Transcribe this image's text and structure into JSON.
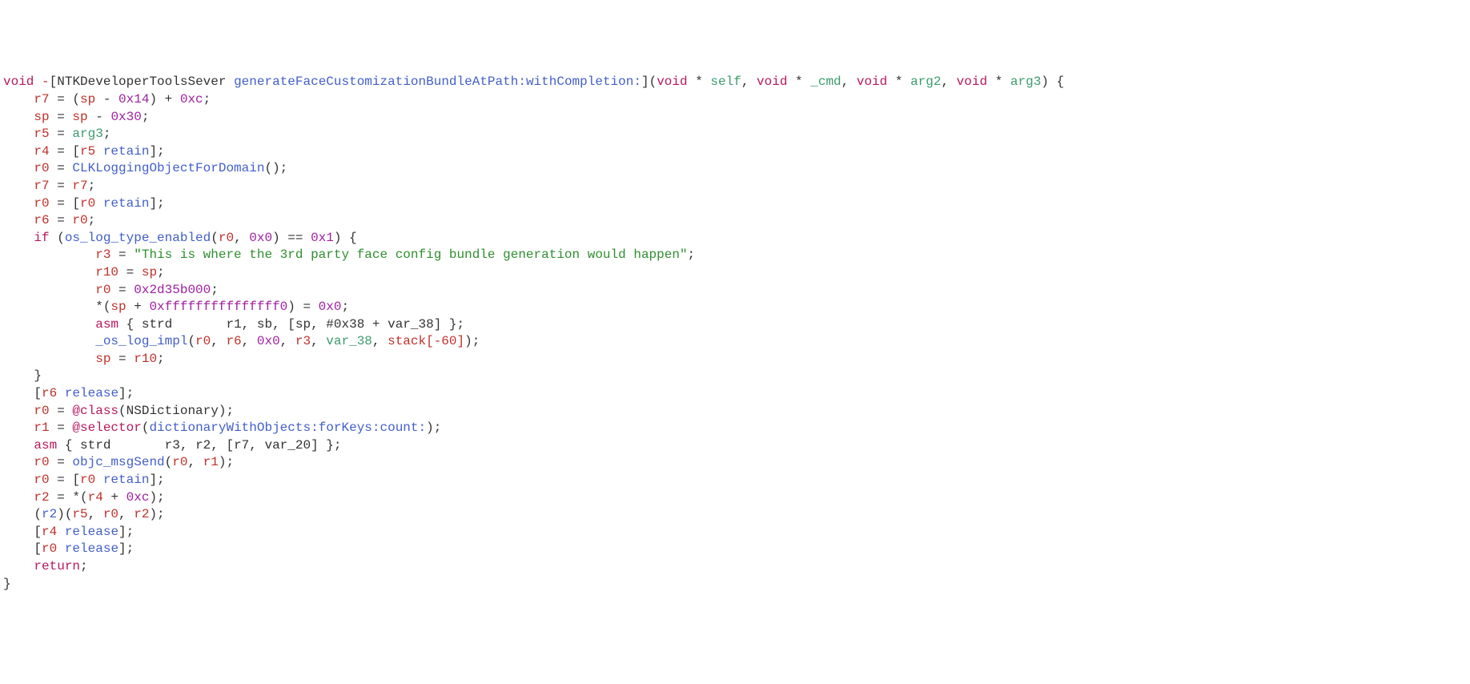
{
  "sig": {
    "ret": "void",
    "minus": "-",
    "lbracket": "[",
    "cls": "NTKDeveloperToolsSever",
    "sel": "generateFaceCustomizationBundleAtPath:withCompletion:",
    "rbracket": "]",
    "lparen": "(",
    "p1t": "void",
    "p1s": " * ",
    "p1n": "self",
    "c1": ", ",
    "p2t": "void",
    "p2s": " * ",
    "p2n": "_cmd",
    "c2": ", ",
    "p3t": "void",
    "p3s": " * ",
    "p3n": "arg2",
    "c3": ", ",
    "p4t": "void",
    "p4s": " * ",
    "p4n": "arg3",
    "rparen": ")",
    "obrace": " {"
  },
  "l1": {
    "r": "r7",
    "eq": " = (",
    "sp": "sp",
    "minus": " - ",
    "v1": "0x14",
    "mid": ") + ",
    "v2": "0xc",
    "end": ";"
  },
  "l2": {
    "r": "sp",
    "eq": " = ",
    "sp2": "sp",
    "minus": " - ",
    "v": "0x30",
    "end": ";"
  },
  "l3": {
    "r": "r5",
    "eq": " = ",
    "a": "arg3",
    "end": ";"
  },
  "l4": {
    "r": "r4",
    "eq": " = [",
    "r2": "r5",
    "sp": " ",
    "m": "retain",
    "end": "];"
  },
  "l5": {
    "r": "r0",
    "eq": " = ",
    "f": "CLKLoggingObjectForDomain",
    "p": "();"
  },
  "l6": {
    "r": "r7",
    "eq": " = ",
    "r2": "r7",
    "end": ";"
  },
  "l7": {
    "r": "r0",
    "eq": " = [",
    "r2": "r0",
    "sp": " ",
    "m": "retain",
    "end": "];"
  },
  "l8": {
    "r": "r6",
    "eq": " = ",
    "r2": "r0",
    "end": ";"
  },
  "l9": {
    "kw": "if",
    "lp": " (",
    "f": "os_log_type_enabled",
    "lpar": "(",
    "a1": "r0",
    "c": ", ",
    "a2": "0x0",
    "rpar": ")",
    "eq": " == ",
    "v": "0x1",
    "rp": ") {"
  },
  "l10": {
    "r": "r3",
    "eq": " = ",
    "s": "\"This is where the 3rd party face config bundle generation would happen\"",
    "end": ";"
  },
  "l11": {
    "r": "r10",
    "eq": " = ",
    "sp": "sp",
    "end": ";"
  },
  "l12": {
    "r": "r0",
    "eq": " = ",
    "v": "0x2d35b000",
    "end": ";"
  },
  "l13": {
    "pre": "*(",
    "sp": "sp",
    "plus": " + ",
    "v": "0xfffffffffffffff0",
    "mid": ") = ",
    "z": "0x0",
    "end": ";"
  },
  "l14": {
    "asm": "asm",
    "lb": " { ",
    "op": "strd",
    "sp": "       ",
    "args": "r1, sb, [sp, #0x38 + var_38] ",
    "rb": "};"
  },
  "l15": {
    "f": "_os_log_impl",
    "lp": "(",
    "a1": "r0",
    "c1": ", ",
    "a2": "r6",
    "c2": ", ",
    "a3": "0x0",
    "c3": ", ",
    "a4": "r3",
    "c4": ", ",
    "a5": "var_38",
    "c5": ", ",
    "a6": "stack[-60]",
    "rp": ");"
  },
  "l16": {
    "r": "sp",
    "eq": " = ",
    "r2": "r10",
    "end": ";"
  },
  "l17": {
    "cb": "}"
  },
  "l18": {
    "lb": "[",
    "r": "r6",
    "sp": " ",
    "m": "release",
    "end": "];"
  },
  "l19": {
    "r": "r0",
    "eq": " = ",
    "at": "@class",
    "lp": "(",
    "cls": "NSDictionary",
    "rp": ");"
  },
  "l20": {
    "r": "r1",
    "eq": " = ",
    "at": "@selector",
    "lp": "(",
    "sel": "dictionaryWithObjects:forKeys:count:",
    "rp": ");"
  },
  "l21": {
    "asm": "asm",
    "lb": " { ",
    "op": "strd",
    "sp": "       ",
    "args": "r3, r2, [r7, var_20] ",
    "rb": "};"
  },
  "l22": {
    "r": "r0",
    "eq": " = ",
    "f": "objc_msgSend",
    "lp": "(",
    "a1": "r0",
    "c": ", ",
    "a2": "r1",
    "rp": ");"
  },
  "l23": {
    "r": "r0",
    "eq": " = [",
    "r2": "r0",
    "sp": " ",
    "m": "retain",
    "end": "];"
  },
  "l24": {
    "r": "r2",
    "eq": " = *(",
    "r2": "r4",
    "plus": " + ",
    "v": "0xc",
    "end": ");"
  },
  "l25": {
    "lp": "(",
    "r1": "r2",
    "rp": ")(",
    "a1": "r5",
    "c1": ", ",
    "a2": "r0",
    "c2": ", ",
    "a3": "r2",
    "end": ");"
  },
  "l26": {
    "lb": "[",
    "r": "r4",
    "sp": " ",
    "m": "release",
    "end": "];"
  },
  "l27": {
    "lb": "[",
    "r": "r0",
    "sp": " ",
    "m": "release",
    "end": "];"
  },
  "l28": {
    "kw": "return",
    "end": ";"
  },
  "l29": {
    "cb": "}"
  }
}
